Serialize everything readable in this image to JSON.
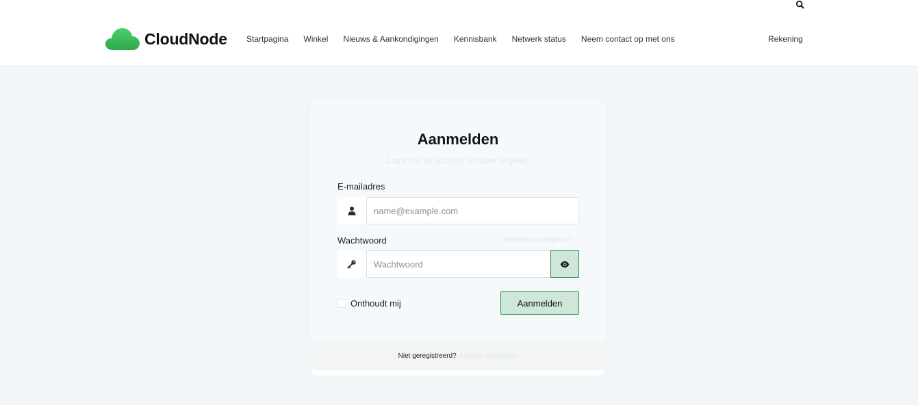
{
  "header": {
    "brand": "CloudNode",
    "nav": [
      {
        "label": "Startpagina"
      },
      {
        "label": "Winkel"
      },
      {
        "label": "Nieuws & Aankondigingen"
      },
      {
        "label": "Kennisbank"
      },
      {
        "label": "Netwerk status"
      },
      {
        "label": "Neem contact op met ons"
      }
    ],
    "account": "Rekening",
    "search_icon": "search-icon"
  },
  "login": {
    "title": "Aanmelden",
    "subtitle": "Log in op uw account om door te gaan.",
    "email_label": "E-mailadres",
    "email_placeholder": "name@example.com",
    "email_value": "",
    "password_label": "Wachtwoord",
    "password_placeholder": "Wachtwoord",
    "password_value": "",
    "forgot": "Wachtwoord vergeten?",
    "remember": "Onthoudt mij",
    "submit": "Aanmelden"
  },
  "footer": {
    "question": "Niet geregistreerd?",
    "register": "Account aanmaken"
  },
  "colors": {
    "accent_border": "#2e8f4b",
    "accent_fill": "#cfe7d8",
    "logo_green": "#3cbf5c",
    "page_bg": "#f2f6f8"
  }
}
